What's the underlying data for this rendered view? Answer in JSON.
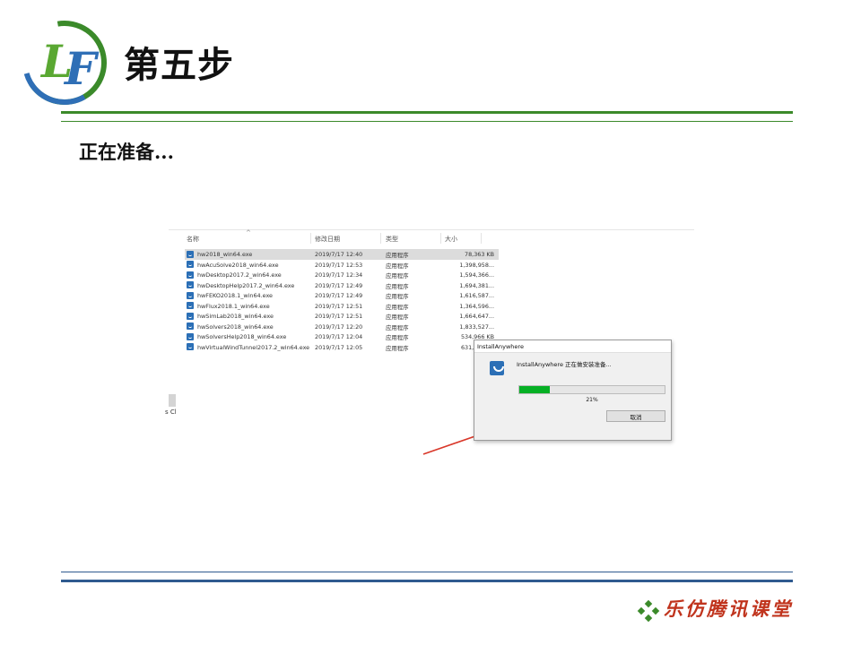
{
  "slide": {
    "title": "第五步",
    "subtitle": "正在准备...",
    "footer": "乐仿腾讯课堂",
    "logo_text": "LF"
  },
  "explorer": {
    "columns": [
      "名称",
      "修改日期",
      "类型",
      "大小"
    ],
    "files": [
      {
        "name": "hw2018_win64.exe",
        "date": "2019/7/17 12:40",
        "type": "应用程序",
        "size": "78,363 KB",
        "selected": true
      },
      {
        "name": "hwAcuSolve2018_win64.exe",
        "date": "2019/7/17 12:53",
        "type": "应用程序",
        "size": "1,398,958..."
      },
      {
        "name": "hwDesktop2017.2_win64.exe",
        "date": "2019/7/17 12:34",
        "type": "应用程序",
        "size": "1,594,366..."
      },
      {
        "name": "hwDesktopHelp2017.2_win64.exe",
        "date": "2019/7/17 12:49",
        "type": "应用程序",
        "size": "1,694,381..."
      },
      {
        "name": "hwFEKO2018.1_win64.exe",
        "date": "2019/7/17 12:49",
        "type": "应用程序",
        "size": "1,616,587..."
      },
      {
        "name": "hwFlux2018.1_win64.exe",
        "date": "2019/7/17 12:51",
        "type": "应用程序",
        "size": "1,364,596..."
      },
      {
        "name": "hwSimLab2018_win64.exe",
        "date": "2019/7/17 12:51",
        "type": "应用程序",
        "size": "1,664,647..."
      },
      {
        "name": "hwSolvers2018_win64.exe",
        "date": "2019/7/17 12:20",
        "type": "应用程序",
        "size": "1,833,527..."
      },
      {
        "name": "hwSolversHelp2018_win64.exe",
        "date": "2019/7/17 12:04",
        "type": "应用程序",
        "size": "534,966 KB"
      },
      {
        "name": "hwVirtualWindTunnel2017.2_win64.exe",
        "date": "2019/7/17 12:05",
        "type": "应用程序",
        "size": "631,957 KB"
      }
    ],
    "left_cut_text": "s Cl"
  },
  "dialog": {
    "title": "InstallAnywhere",
    "message": "InstallAnywhere 正在做安装准备...",
    "progress_percent": 21,
    "progress_label": "21%",
    "cancel_label": "取消"
  },
  "colors": {
    "accent_green": "#3b8a2a",
    "accent_blue": "#2f5a8f",
    "footer_red": "#c0341d",
    "progress_green": "#06b025",
    "arrow_red": "#d9382a"
  },
  "icons": {
    "logo": "lf-logo-icon",
    "file": "installer-file-icon",
    "dialog": "installanywhere-icon",
    "footer": "diamond-cluster-icon"
  }
}
